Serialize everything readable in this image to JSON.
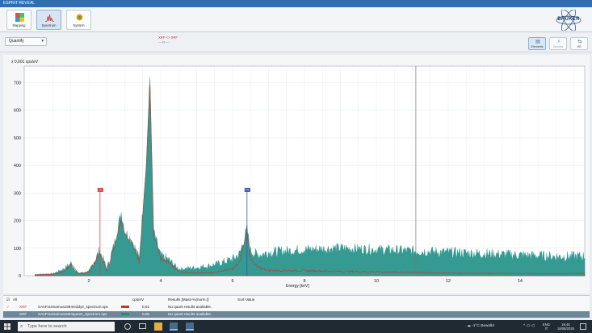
{
  "window": {
    "title": "ESPRIT REVEAL"
  },
  "ribbon": {
    "buttons": [
      {
        "label": "Mapping",
        "icon": "mapping-icon"
      },
      {
        "label": "Spectrum",
        "icon": "spectrum-icon",
        "active": true
      },
      {
        "label": "System",
        "icon": "system-icon"
      }
    ],
    "logo": "BRUKER"
  },
  "toolbar": {
    "quantify_label": "Quantify",
    "legend_line1": "XRF   <> XRF",
    "legend_line2": "--    <> --",
    "right_buttons": [
      {
        "label": "Elements",
        "icon": "elements-icon",
        "active": true
      },
      {
        "label": "Spectra",
        "icon": "spectra-icon",
        "disabled": true
      },
      {
        "label": "I/O",
        "icon": "io-icon"
      }
    ]
  },
  "colors": {
    "accent": "#2f6fb1",
    "spectrum_fill": "#1f8f86",
    "spectrum_red": "#c0392b",
    "marker_red": "#d64541",
    "marker_blue": "#3a55a8"
  },
  "chart_data": {
    "type": "area",
    "ylabel": "x 0,001 cps/eV",
    "xlabel": "Energy [keV]",
    "xlim": [
      0.2,
      15.8
    ],
    "ylim": [
      0,
      760
    ],
    "xticks": [
      2,
      4,
      6,
      8,
      10,
      12,
      14
    ],
    "yticks": [
      0,
      100,
      200,
      300,
      400,
      500,
      600,
      700
    ],
    "grid": true,
    "cursor_x": 11.1,
    "markers": [
      {
        "label": "S",
        "x": 2.31,
        "y": 310,
        "color": "#d64541"
      },
      {
        "label": "Fe",
        "x": 6.4,
        "y": 310,
        "color": "#3a55a8"
      }
    ],
    "series": [
      {
        "name": "SAnFranSamoa1894reddye_spectrum.spx",
        "color": "#c0392b",
        "x": [
          0.5,
          1.0,
          1.3,
          1.5,
          1.7,
          2.0,
          2.3,
          2.5,
          2.7,
          2.9,
          3.0,
          3.2,
          3.4,
          3.6,
          3.7,
          3.8,
          4.0,
          4.2,
          4.5,
          5.0,
          5.5,
          6.0,
          6.2,
          6.4,
          6.5,
          6.7,
          7.0,
          8.0,
          10.0,
          12.0,
          14.0,
          15.8
        ],
        "values": [
          3,
          5,
          15,
          40,
          8,
          12,
          80,
          20,
          100,
          200,
          150,
          120,
          50,
          400,
          700,
          150,
          60,
          50,
          15,
          10,
          12,
          25,
          50,
          160,
          60,
          30,
          20,
          18,
          14,
          10,
          8,
          8
        ]
      },
      {
        "name": "SAnFranSamoa1894queen_spectrum.spx",
        "color": "#1f8f86",
        "x": [
          0.5,
          1.0,
          1.3,
          1.5,
          1.7,
          2.0,
          2.3,
          2.5,
          2.7,
          2.9,
          3.0,
          3.2,
          3.4,
          3.6,
          3.7,
          3.8,
          4.0,
          4.2,
          4.5,
          5.0,
          5.5,
          6.0,
          6.2,
          6.4,
          6.5,
          6.7,
          7.0,
          7.5,
          8.0,
          9.0,
          10.0,
          11.0,
          12.0,
          13.0,
          14.0,
          15.0,
          15.8
        ],
        "values": [
          5,
          8,
          25,
          45,
          10,
          15,
          90,
          25,
          110,
          230,
          160,
          130,
          60,
          420,
          720,
          160,
          70,
          60,
          25,
          30,
          40,
          60,
          80,
          170,
          90,
          75,
          85,
          90,
          95,
          100,
          95,
          90,
          85,
          80,
          75,
          70,
          70
        ]
      }
    ]
  },
  "results": {
    "header": {
      "all": "All",
      "cps": "cps/eV",
      "results": "Results [Mass-%(norm.)]",
      "sort": "Sort-Value"
    },
    "rows": [
      {
        "type": "XRF",
        "name": "SAnFranSamoa1894reddye_spectrum.spx",
        "value": "0,01",
        "status": "No quant results available."
      },
      {
        "type": "XRF",
        "name": "SAnFranSamoa1894queen_spectrum.spx",
        "value": "0,05",
        "status": "No quant results available."
      }
    ]
  },
  "taskbar": {
    "search_placeholder": "Type here to search",
    "weather": "-1°C  Bewolkt",
    "lang": "ENG",
    "region": "IT",
    "time": "16:46",
    "date": "18/08/2025"
  }
}
